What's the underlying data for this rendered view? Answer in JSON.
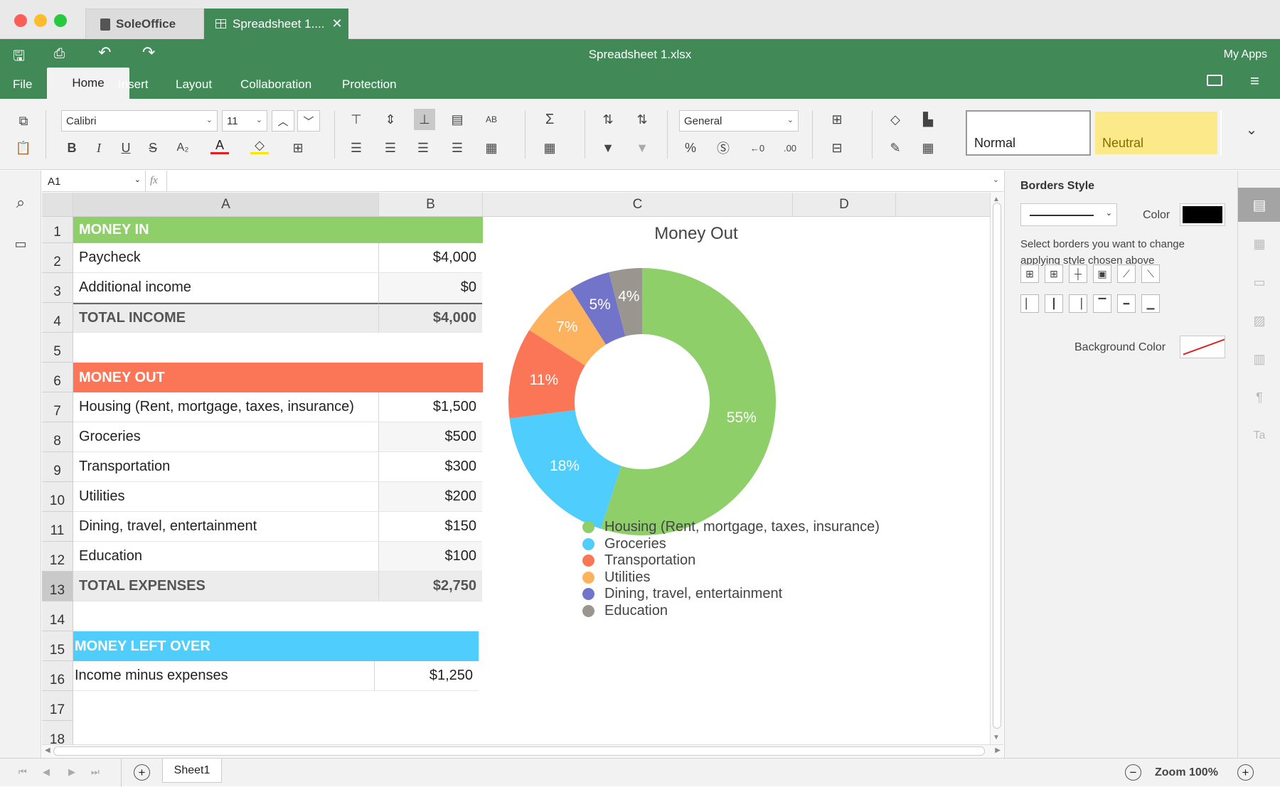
{
  "window": {
    "tab1": "SoleOffice",
    "tab2": "Spreadsheet 1....",
    "title": "Spreadsheet 1.xlsx",
    "my_apps": "My Apps"
  },
  "menu": {
    "file": "File",
    "home": "Home",
    "insert": "Insert",
    "layout": "Layout",
    "collaboration": "Collaboration",
    "protection": "Protection"
  },
  "ribbon": {
    "font": "Calibri",
    "font_size": "11",
    "number_format": "General",
    "style_normal": "Normal",
    "style_neutral": "Neutral"
  },
  "formula_bar": {
    "cell_ref": "A1",
    "fx": "fx",
    "value": ""
  },
  "columns": [
    "A",
    "B",
    "C",
    "D"
  ],
  "rows": [
    "1",
    "2",
    "3",
    "4",
    "5",
    "6",
    "7",
    "8",
    "9",
    "10",
    "11",
    "12",
    "13",
    "14",
    "15",
    "16",
    "17",
    "18"
  ],
  "sheet": {
    "r1": "MONEY IN",
    "r2a": "Paycheck",
    "r2b": "$4,000",
    "r3a": "Additional income",
    "r3b": "$0",
    "r4a": "TOTAL INCOME",
    "r4b": "$4,000",
    "r6": "MONEY OUT",
    "r7a": "Housing (Rent, mortgage, taxes, insurance)",
    "r7b": "$1,500",
    "r8a": "Groceries",
    "r8b": "$500",
    "r9a": "Transportation",
    "r9b": "$300",
    "r10a": "Utilities",
    "r10b": "$200",
    "r11a": "Dining, travel, entertainment",
    "r11b": "$150",
    "r12a": "Education",
    "r12b": "$100",
    "r13a": "TOTAL EXPENSES",
    "r13b": "$2,750",
    "r15": "MONEY LEFT OVER",
    "r16a": "Income minus expenses",
    "r16b": "$1,250"
  },
  "chart_data": {
    "type": "pie",
    "title": "Money Out",
    "categories": [
      "Housing (Rent, mortgage, taxes, insurance)",
      "Groceries",
      "Transportation",
      "Utilities",
      "Dining, travel, entertainment",
      "Education"
    ],
    "values": [
      55,
      18,
      11,
      7,
      5,
      4
    ],
    "labels": [
      "55%",
      "18%",
      "11%",
      "7%",
      "5%",
      "4%"
    ],
    "colors": [
      "#8ecf6a",
      "#4fcdfc",
      "#fa7656",
      "#fdb35d",
      "#7174c9",
      "#9a958f"
    ],
    "legend_position": "bottom"
  },
  "right_panel": {
    "title": "Borders Style",
    "color_label": "Color",
    "hint": "Select borders you want to change applying style chosen above",
    "bg_label": "Background Color"
  },
  "status": {
    "sheet_tab": "Sheet1",
    "zoom": "Zoom 100%"
  }
}
